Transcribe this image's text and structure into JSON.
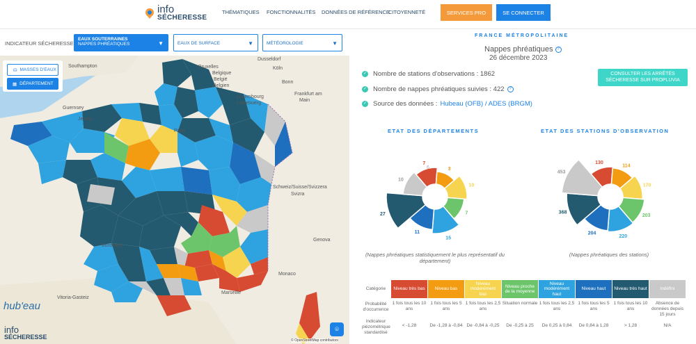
{
  "header": {
    "logo_info": "info",
    "logo_secheresse": "SÉCHERESSE",
    "nav": [
      "THÉMATIQUES",
      "FONCTIONNALITÉS",
      "DONNÉES DE RÉFÉRENCE",
      "CITOYENNETÉ"
    ],
    "services_label": "SERVICES PRO",
    "login_label": "SE CONNECTER"
  },
  "selectors": {
    "label": "INDICATEUR SÉCHERESSE :",
    "eaux_souterraines_line1": "EAUX SOUTERRAINES",
    "eaux_souterraines_line2": "NAPPES PHRÉATIQUES",
    "eaux_surface": "EAUX DE SURFACE",
    "meteorologie": "MÉTÉOROLOGIE"
  },
  "map": {
    "masses_label": "MASSES D'EAUX",
    "departement_label": "DÉPARTEMENT",
    "hubeau": "hub'eau",
    "attribution": "© OpenStreetMap contributors",
    "places": [
      "Southampton",
      "Bruxelles",
      "Dusseldorf",
      "Belgique",
      "België",
      "Belgien",
      "Köln",
      "Bonn",
      "Frankfurt am",
      "Main",
      "Guernsey",
      "Luxembourg",
      "Lëtzebuerg",
      "Jersey",
      "Paris",
      "Schweiz/Suisse/Svizzera",
      "Svizra",
      "Bordeaux",
      "Vitoria-Gasteiz",
      "Marseille",
      "Monaco",
      "Genova"
    ],
    "colors": {
      "very_low": "#d84b33",
      "low": "#f39c12",
      "moderately_low": "#f7d44f",
      "near_avg": "#6cc56a",
      "moderately_high": "#2fa3e0",
      "high": "#1f6fbf",
      "very_high": "#245a70",
      "none": "#c9c9c9"
    }
  },
  "panel": {
    "region": "FRANCE MÉTROPOLITAINE",
    "subtitle": "Nappes phréatiques",
    "date": "26 décembre 2023",
    "stat_stations": "Nombre de stations d'observations : 1862",
    "stat_nappes": "Nombre de nappes phréatiques suivies : 422",
    "stat_source_prefix": "Source des données :",
    "stat_source_link": "Hubeau (OFB) / ADES (BRGM)",
    "propluvia_line1": "CONSULTER LES ARRÊTÉS",
    "propluvia_line2": "SÉCHERESSE SUR PROPLUVIA",
    "dept_title": "ETAT DES DÉPARTEMENTS",
    "stations_title": "ETAT DES STATIONS D'OBSERVATION",
    "dept_caption_1": "(Nappes phréatiques statistiquement le plus représentatif du",
    "dept_caption_2": "département)",
    "stations_caption": "(Nappes phréatiques des stations)"
  },
  "chart_data": [
    {
      "type": "pie",
      "title": "ETAT DES DÉPARTEMENTS",
      "categories": [
        "Niveau très bas",
        "Niveau bas",
        "Niveau modérément bas",
        "Niveau proche de la moyenne",
        "Niveau modérément haut",
        "Niveau haut",
        "Niveau très haut",
        "Indéfini"
      ],
      "values": [
        7,
        3,
        10,
        7,
        15,
        11,
        27,
        10
      ],
      "labels": [
        "7",
        "3",
        "10",
        "7",
        "15",
        "11",
        "27",
        "10"
      ],
      "extra_label": "6",
      "colors": [
        "#d84b33",
        "#f39c12",
        "#f7d44f",
        "#6cc56a",
        "#2fa3e0",
        "#1f6fbf",
        "#245a70",
        "#c9c9c9"
      ]
    },
    {
      "type": "pie",
      "title": "ETAT DES STATIONS D'OBSERVATION",
      "categories": [
        "Niveau très bas",
        "Niveau bas",
        "Niveau modérément bas",
        "Niveau proche de la moyenne",
        "Niveau modérément haut",
        "Niveau haut",
        "Niveau très haut",
        "Indéfini"
      ],
      "values": [
        130,
        114,
        170,
        203,
        220,
        204,
        368,
        453
      ],
      "labels": [
        "130",
        "114",
        "170",
        "203",
        "220",
        "204",
        "368",
        "453"
      ],
      "colors": [
        "#d84b33",
        "#f39c12",
        "#f7d44f",
        "#6cc56a",
        "#2fa3e0",
        "#1f6fbf",
        "#245a70",
        "#c9c9c9"
      ]
    }
  ],
  "legend": {
    "row_category": "Catégorie",
    "row_proba_1": "Probabilité",
    "row_proba_2": "d'occurrence",
    "row_indic_1": "Indicateur",
    "row_indic_2": "piézométrique",
    "row_indic_3": "standardisé",
    "categories": [
      {
        "name": "Niveau très bas",
        "color": "#d84b33",
        "proba": "1 fois tous les 10 ans",
        "indic": "< -1,28"
      },
      {
        "name": "Niveau bas",
        "color": "#f39c12",
        "proba": "1 fois tous les 5 ans",
        "indic": "De -1,28 à -0,84"
      },
      {
        "name": "Niveau modérément bas",
        "color": "#f7d44f",
        "proba": "1 fois tous les 2,5 ans",
        "indic": "De -0,84 à -0,25"
      },
      {
        "name": "Niveau proche de la moyenne",
        "color": "#6cc56a",
        "proba": "Situation normale",
        "indic": "De -0,25 à 25"
      },
      {
        "name": "Niveau modérément haut",
        "color": "#2fa3e0",
        "proba": "1 fois tous les 2,5 ans",
        "indic": "De 0,25 à 0,84"
      },
      {
        "name": "Niveau haut",
        "color": "#1f6fbf",
        "proba": "1 fois tous les 5 ans",
        "indic": "De 0,84 à 1,28"
      },
      {
        "name": "Niveau très haut",
        "color": "#245a70",
        "proba": "1 fois tous les 10 ans",
        "indic": "> 1,28"
      },
      {
        "name": "Indéfini",
        "color": "#c9c9c9",
        "proba": "Absence de données depuis 15 jours",
        "indic": "N/A"
      }
    ]
  }
}
